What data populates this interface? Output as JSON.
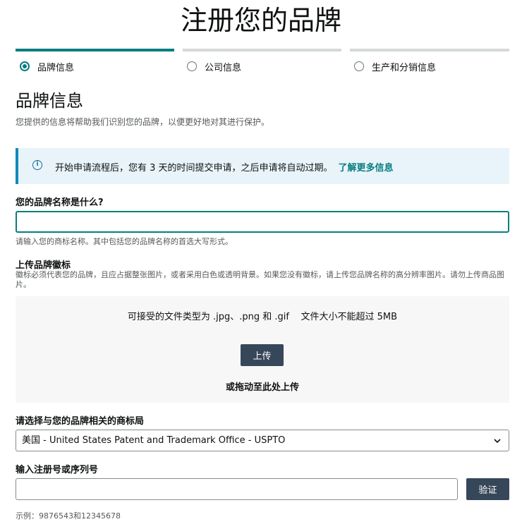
{
  "page": {
    "title": "注册您的品牌"
  },
  "steps": [
    {
      "label": "品牌信息",
      "active": true
    },
    {
      "label": "公司信息",
      "active": false
    },
    {
      "label": "生产和分销信息",
      "active": false
    }
  ],
  "section": {
    "title": "品牌信息",
    "description": "您提供的信息将帮助我们识别您的品牌，以便更好地对其进行保护。"
  },
  "info": {
    "icon": "info-icon",
    "text": "开始申请流程后，您有 3 天的时间提交申请，之后申请将自动过期。",
    "link": "了解更多信息"
  },
  "brand_name": {
    "label": "您的品牌名称是什么?",
    "value": "",
    "hint": "请输入您的商标名称。其中包括您的品牌名称的首选大写形式。"
  },
  "logo": {
    "label": "上传品牌徽标",
    "hint": "徽标必须代表您的品牌，且应占据整张图片，或者采用白色或透明背景。如果您没有徽标，请上传您品牌名称的高分辨率图片。请勿上传商品图片。",
    "requirements": "可接受的文件类型为 .jpg、.png 和 .gif    文件大小不能超过 5MB",
    "button": "上传",
    "drop_text": "或拖动至此处上传"
  },
  "trademark_office": {
    "label": "请选择与您的品牌相关的商标局",
    "selected": "美国 - United States Patent and Trademark Office - USPTO"
  },
  "registration": {
    "label": "输入注册号或序列号",
    "value": "",
    "button": "验证",
    "example": "示例：9876543和12345678"
  },
  "colors": {
    "accent": "#067d80",
    "button": "#37475a",
    "info_bg": "#e8f4fa"
  }
}
